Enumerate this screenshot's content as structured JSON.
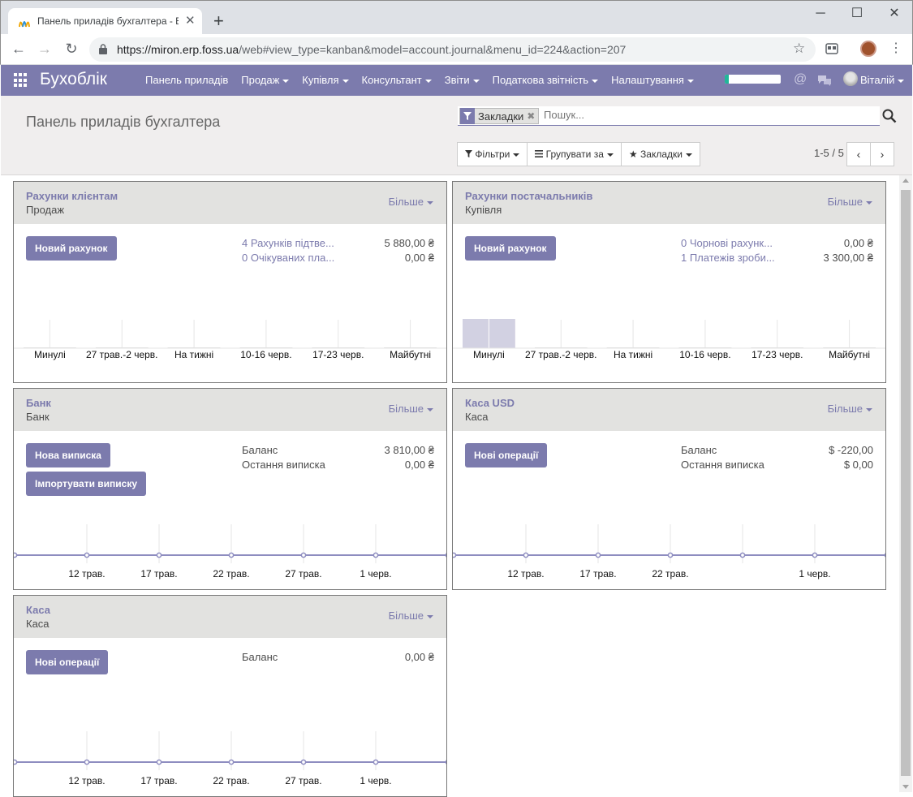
{
  "browser": {
    "tab_title": "Панель приладів бухгалтера - E",
    "url_host": "https://miron.erp.foss.ua",
    "url_path": "/web#view_type=kanban&model=account.journal&menu_id=224&action=207"
  },
  "navbar": {
    "brand": "Бухоблік",
    "menu": [
      "Панель приладів",
      "Продаж",
      "Купівля",
      "Консультант",
      "Звіти",
      "Податкова звітність",
      "Налаштування"
    ],
    "menu_has_caret": [
      false,
      true,
      true,
      true,
      true,
      true,
      true
    ],
    "progress_fraction": 0.07,
    "user": "Віталій",
    "colors": {
      "bar": "#7c7bad",
      "progress": "#21b799"
    }
  },
  "control_panel": {
    "title": "Панель приладів бухгалтера",
    "facet": "Закладки",
    "search_placeholder": "Пошук...",
    "buttons": {
      "filters": "Фільтри",
      "group_by": "Групувати за",
      "favorites": "Закладки"
    },
    "pager": "1-5 / 5"
  },
  "cards": [
    {
      "name": "Рахунки клієнтам",
      "type": "Продаж",
      "more": "Більше",
      "buttons": [
        "Новий рахунок"
      ],
      "stats": [
        {
          "label": "4 Рахунків підтве...",
          "value": "5 880,00 ₴",
          "link": true
        },
        {
          "label": "0 Очікуваних пла...",
          "value": "0,00 ₴",
          "link": true
        }
      ],
      "chart_data": {
        "type": "bar",
        "categories": [
          "Минулі",
          "27 трав.-2 черв.",
          "На тижні",
          "10-16 черв.",
          "17-23 черв.",
          "Майбутні"
        ],
        "values": [
          0,
          0,
          0,
          0,
          0,
          0
        ]
      }
    },
    {
      "name": "Рахунки постачальників",
      "type": "Купівля",
      "more": "Більше",
      "buttons": [
        "Новий рахунок"
      ],
      "stats": [
        {
          "label": "0 Чорнові рахунк...",
          "value": "0,00 ₴",
          "link": true
        },
        {
          "label": "1 Платежів зроби...",
          "value": "3 300,00 ₴",
          "link": true
        }
      ],
      "chart_data": {
        "type": "bar",
        "categories": [
          "Минулі",
          "27 трав.-2 черв.",
          "На тижні",
          "10-16 черв.",
          "17-23 черв.",
          "Майбутні"
        ],
        "values": [
          3300,
          0,
          0,
          0,
          0,
          0
        ]
      }
    },
    {
      "name": "Банк",
      "type": "Банк",
      "more": "Більше",
      "buttons": [
        "Нова виписка",
        "Імпортувати виписку"
      ],
      "stats": [
        {
          "label": "Баланс",
          "value": "3 810,00 ₴",
          "link": false
        },
        {
          "label": "Остання виписка",
          "value": "0,00 ₴",
          "link": false
        }
      ],
      "chart_data": {
        "type": "line",
        "x": [
          "12 трав.",
          "17 трав.",
          "22 трав.",
          "27 трав.",
          "1 черв."
        ],
        "values": [
          0,
          0,
          0,
          0,
          0,
          0,
          0
        ]
      }
    },
    {
      "name": "Каса USD",
      "type": "Каса",
      "more": "Більше",
      "buttons": [
        "Нові операції"
      ],
      "stats": [
        {
          "label": "Баланс",
          "value": "$ -220,00",
          "link": false
        },
        {
          "label": "Остання виписка",
          "value": "$ 0,00",
          "link": false
        }
      ],
      "chart_data": {
        "type": "line",
        "x": [
          "12 трав.",
          "17 трав.",
          "22 трав.",
          "",
          "1 черв."
        ],
        "values": [
          0,
          0,
          0,
          0,
          0,
          0,
          0
        ]
      }
    },
    {
      "name": "Каса",
      "type": "Каса",
      "more": "Більше",
      "buttons": [
        "Нові операції"
      ],
      "stats": [
        {
          "label": "Баланс",
          "value": "0,00 ₴",
          "link": false
        }
      ],
      "chart_data": {
        "type": "line",
        "x": [
          "12 трав.",
          "17 трав.",
          "22 трав.",
          "27 трав.",
          "1 черв."
        ],
        "values": [
          0,
          0,
          0,
          0,
          0,
          0,
          0
        ]
      }
    }
  ]
}
